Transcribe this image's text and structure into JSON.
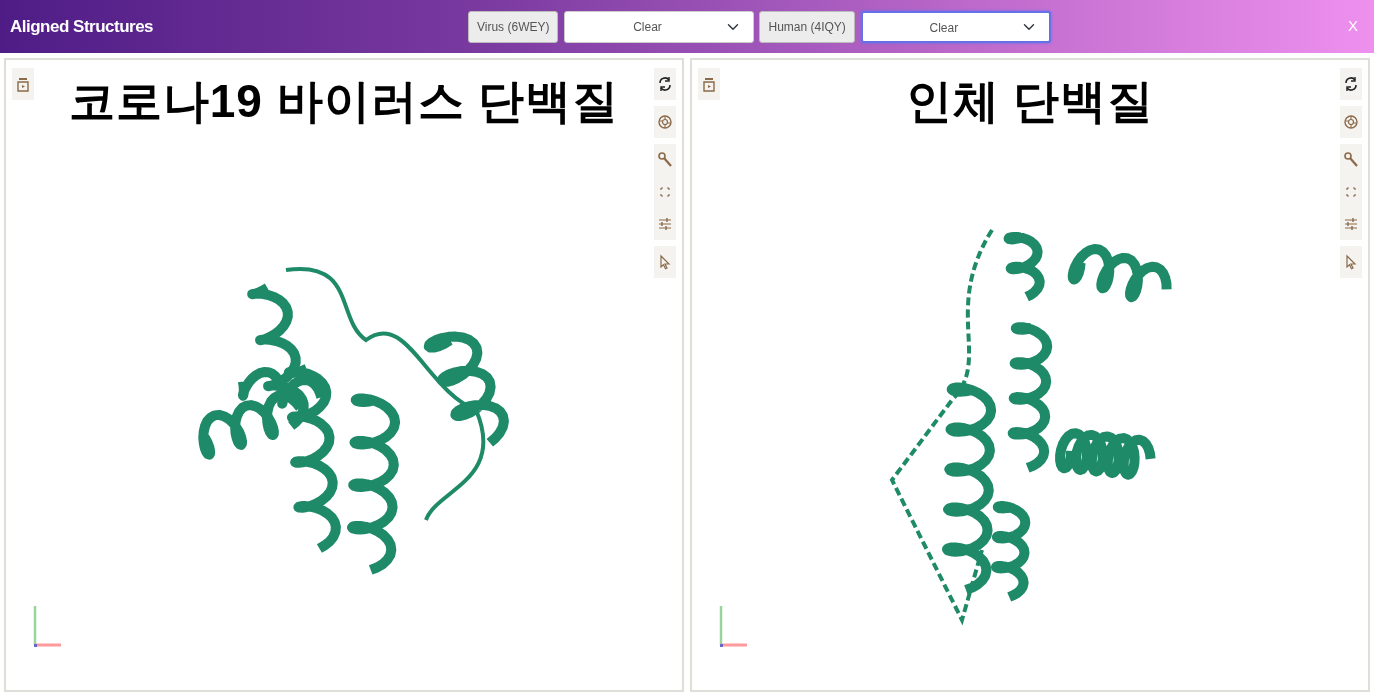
{
  "header": {
    "title": "Aligned Structures",
    "close": "X",
    "controls": [
      {
        "label": "Virus (6WEY)",
        "select": "Clear",
        "focused": false
      },
      {
        "label": "Human (4IQY)",
        "select": "Clear",
        "focused": true
      }
    ]
  },
  "viewers": [
    {
      "caption": "코로나19 바이러스 단백질"
    },
    {
      "caption": "인체 단백질"
    }
  ]
}
